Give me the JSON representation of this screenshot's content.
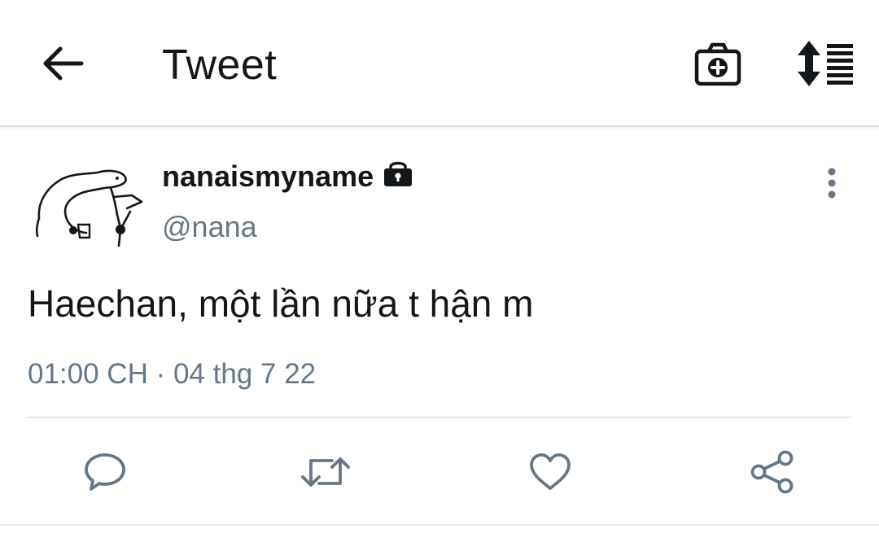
{
  "header": {
    "title": "Tweet",
    "back_icon": "arrow-left-icon",
    "camera_icon": "camera-plus-icon",
    "sort_icon": "sort-list-icon"
  },
  "tweet": {
    "display_name": "nanaismyname",
    "handle": "@nana",
    "protected_icon": "lock-icon",
    "text": "Haechan, một lần nữa t hận m",
    "timestamp": "01:00 CH · 04 thg 7 22",
    "more_icon": "more-vertical-icon"
  },
  "actions": [
    {
      "name": "reply",
      "icon": "comment-icon"
    },
    {
      "name": "retweet",
      "icon": "retweet-icon"
    },
    {
      "name": "like",
      "icon": "heart-icon"
    },
    {
      "name": "share",
      "icon": "share-icon"
    }
  ],
  "colors": {
    "text_primary": "#14171a",
    "text_secondary": "#657786",
    "divider": "#e1e8ed",
    "icon_gray": "#657786"
  }
}
